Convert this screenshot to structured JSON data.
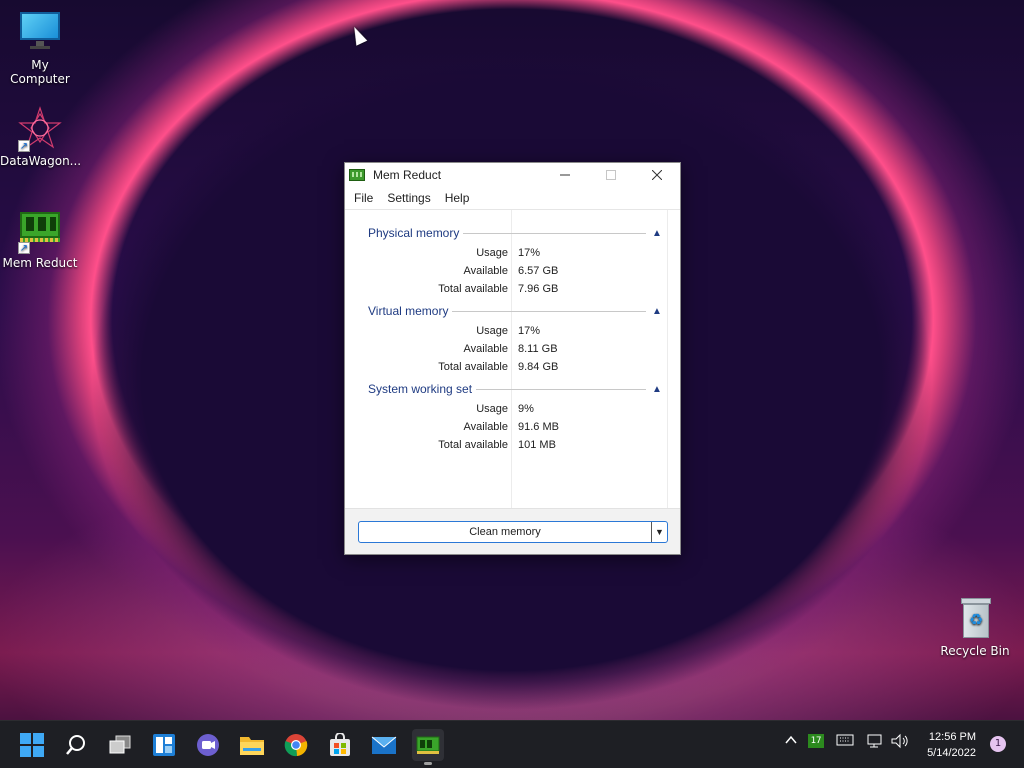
{
  "desktop": {
    "icons": [
      {
        "label": "My Computer"
      },
      {
        "label": "DataWagon..."
      },
      {
        "label": "Mem Reduct"
      },
      {
        "label": "Recycle Bin"
      }
    ]
  },
  "window": {
    "title": "Mem Reduct",
    "menu": [
      "File",
      "Settings",
      "Help"
    ],
    "groups": [
      {
        "title": "Physical memory",
        "rows": [
          {
            "label": "Usage",
            "value": "17%"
          },
          {
            "label": "Available",
            "value": "6.57 GB"
          },
          {
            "label": "Total available",
            "value": "7.96 GB"
          }
        ]
      },
      {
        "title": "Virtual memory",
        "rows": [
          {
            "label": "Usage",
            "value": "17%"
          },
          {
            "label": "Available",
            "value": "8.11 GB"
          },
          {
            "label": "Total available",
            "value": "9.84 GB"
          }
        ]
      },
      {
        "title": "System working set",
        "rows": [
          {
            "label": "Usage",
            "value": "9%"
          },
          {
            "label": "Available",
            "value": "91.6 MB"
          },
          {
            "label": "Total available",
            "value": "101 MB"
          }
        ]
      }
    ],
    "clean_button": "Clean memory"
  },
  "taskbar": {
    "apps": [
      "start-icon",
      "search-icon",
      "task-view-icon",
      "widgets-icon",
      "teams-chat-icon",
      "file-explorer-icon",
      "chrome-icon",
      "store-icon",
      "mail-icon",
      "mem-reduct-icon"
    ],
    "tray_badge": "17",
    "time": "12:56 PM",
    "date": "5/14/2022",
    "notifications": "1"
  }
}
